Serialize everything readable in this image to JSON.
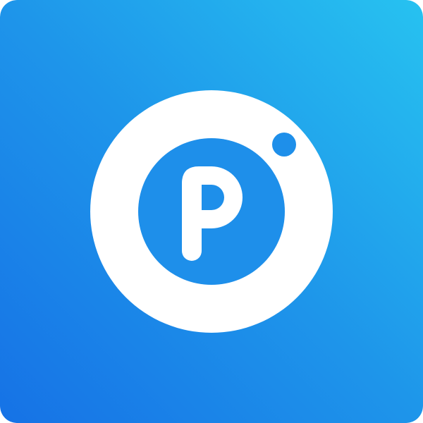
{
  "icon": {
    "name": "p-camera-logo-icon",
    "colors": {
      "gradient_start": "#1672E6",
      "gradient_mid": "#1E95EA",
      "gradient_end": "#27C2F0",
      "ring": "#FFFFFF",
      "inner": "#1E8FEA",
      "dot": "#1E8FEA",
      "letter": "#FFFFFF"
    }
  }
}
